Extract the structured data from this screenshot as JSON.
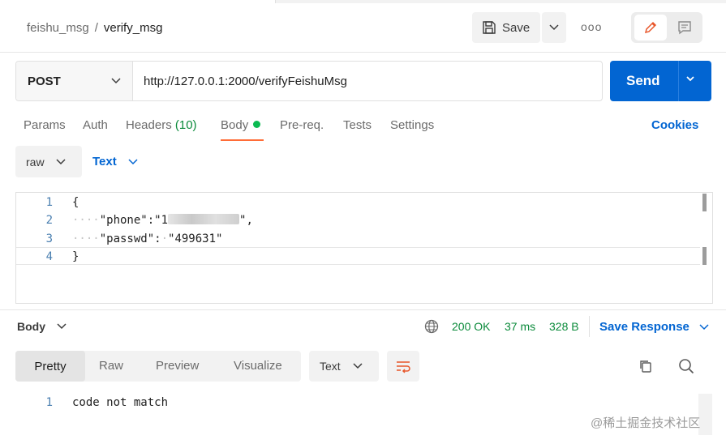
{
  "breadcrumb": {
    "parent": "feishu_msg",
    "separator": "/",
    "current": "verify_msg"
  },
  "toolbar": {
    "save_label": "Save",
    "more_label": "ooo"
  },
  "request": {
    "method": "POST",
    "url": "http://127.0.0.1:2000/verifyFeishuMsg",
    "send_label": "Send"
  },
  "request_tabs": {
    "params": "Params",
    "auth": "Auth",
    "headers": "Headers",
    "headers_count": "(10)",
    "body": "Body",
    "prereq": "Pre-req.",
    "tests": "Tests",
    "settings": "Settings",
    "cookies": "Cookies"
  },
  "body_options": {
    "mode": "raw",
    "language": "Text"
  },
  "editor": {
    "line_numbers": [
      "1",
      "2",
      "3",
      "4"
    ],
    "l1": "{",
    "l2_ws": "····",
    "l2_key": "\"phone\":\"1",
    "l2_end": "\",",
    "l3_ws": "····",
    "l3_key": "\"passwd\":",
    "l3_ws2": "·",
    "l3_val": "\"499631\"",
    "l4": "}"
  },
  "response": {
    "section_label": "Body",
    "status": "200 OK",
    "time": "37 ms",
    "size": "328 B",
    "save_response": "Save Response",
    "views": {
      "pretty": "Pretty",
      "raw": "Raw",
      "preview": "Preview",
      "visualize": "Visualize"
    },
    "format": "Text",
    "lines": [
      {
        "n": "1",
        "text": "code not match"
      }
    ]
  },
  "watermark": "@稀土掘金技术社区",
  "colors": {
    "accent_blue": "#0265d2",
    "status_green": "#0a8a3a",
    "active_tab": "#ff6c37",
    "body_dot": "#0cbb52"
  }
}
